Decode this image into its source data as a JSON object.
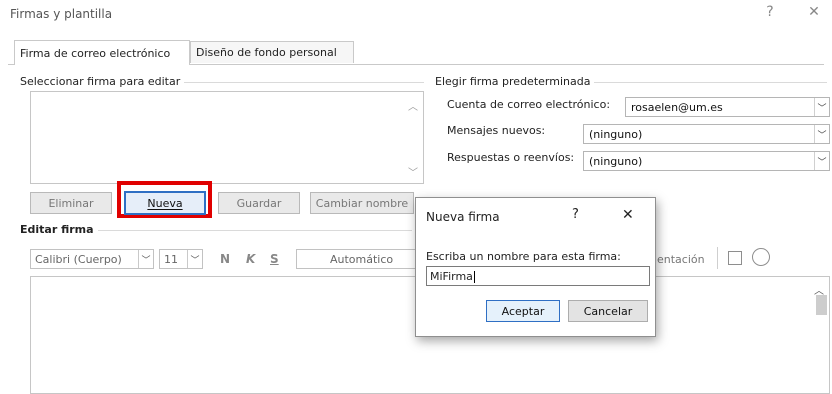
{
  "window": {
    "title": "Firmas y plantilla",
    "help_glyph": "?",
    "close_glyph": "✕"
  },
  "tabs": [
    {
      "label": "Firma de correo electrónico",
      "active": true
    },
    {
      "label": "Diseño de fondo personal",
      "active": false
    }
  ],
  "select_signature": {
    "group_label": "Seleccionar firma para editar",
    "buttons": {
      "delete": "Eliminar",
      "new": "Nueva",
      "save": "Guardar",
      "rename": "Cambiar nombre"
    }
  },
  "default_signature": {
    "group_label": "Elegir firma predeterminada",
    "account_label": "Cuenta de correo electrónico:",
    "account_value": "rosaelen@um.es",
    "new_messages_label": "Mensajes nuevos:",
    "new_messages_value": "(ninguno)",
    "replies_label": "Respuestas o reenvíos:",
    "replies_value": "(ninguno)"
  },
  "edit_signature": {
    "group_label": "Editar firma",
    "font_value": "Calibri (Cuerpo)",
    "size_value": "11",
    "bold": "N",
    "italic": "K",
    "underline": "S",
    "color_value": "Automático",
    "business_card_partial": "entación"
  },
  "dialog": {
    "title": "Nueva firma",
    "help_glyph": "?",
    "close_glyph": "✕",
    "prompt": "Escriba un nombre para esta firma:",
    "input_value": "MiFirma",
    "ok": "Aceptar",
    "cancel": "Cancelar"
  },
  "colors": {
    "highlight": "#e00000",
    "focus": "#2f6fc4"
  }
}
